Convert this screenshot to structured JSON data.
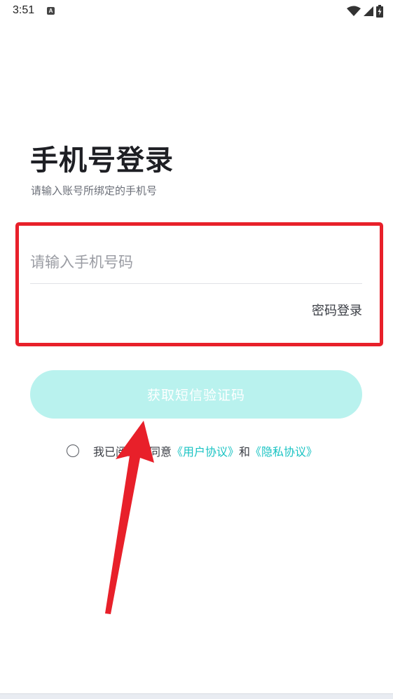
{
  "status_bar": {
    "time": "3:51",
    "notification_icon": "a-notification-icon",
    "icons": [
      "wifi-icon",
      "cell-signal-icon",
      "battery-charging-icon"
    ]
  },
  "header": {
    "title": "手机号登录",
    "subtitle": "请输入账号所绑定的手机号"
  },
  "form": {
    "phone_placeholder": "请输入手机号码",
    "phone_value": "",
    "password_login_label": "密码登录",
    "sms_button_label": "获取短信验证码"
  },
  "agreement": {
    "prefix": "我已阅读并同意",
    "user_agreement": "《用户协议》",
    "conjunction": "和",
    "privacy_policy": "《隐私协议》",
    "checked": false
  },
  "colors": {
    "accent": "#19c3c3",
    "button_bg": "#b9f2ee",
    "annotation_red": "#e8202a"
  }
}
